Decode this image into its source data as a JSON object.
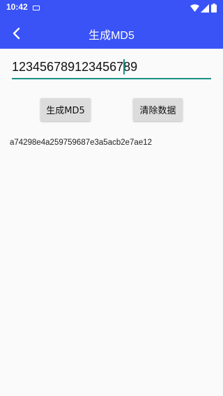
{
  "status_bar": {
    "time": "10:42",
    "icons": [
      "notification-icon",
      "wifi-icon",
      "signal-icon",
      "battery-icon"
    ]
  },
  "app_bar": {
    "back_icon": "chevron-left-icon",
    "title": "生成MD5",
    "background": "#3a53f7"
  },
  "input": {
    "value": "123456789123456789",
    "underline_color": "#169184"
  },
  "buttons": {
    "generate_label": "生成MD5",
    "clear_label": "清除数据"
  },
  "result": {
    "text": "a74298e4a259759687e3a5acb2e7ae12"
  }
}
